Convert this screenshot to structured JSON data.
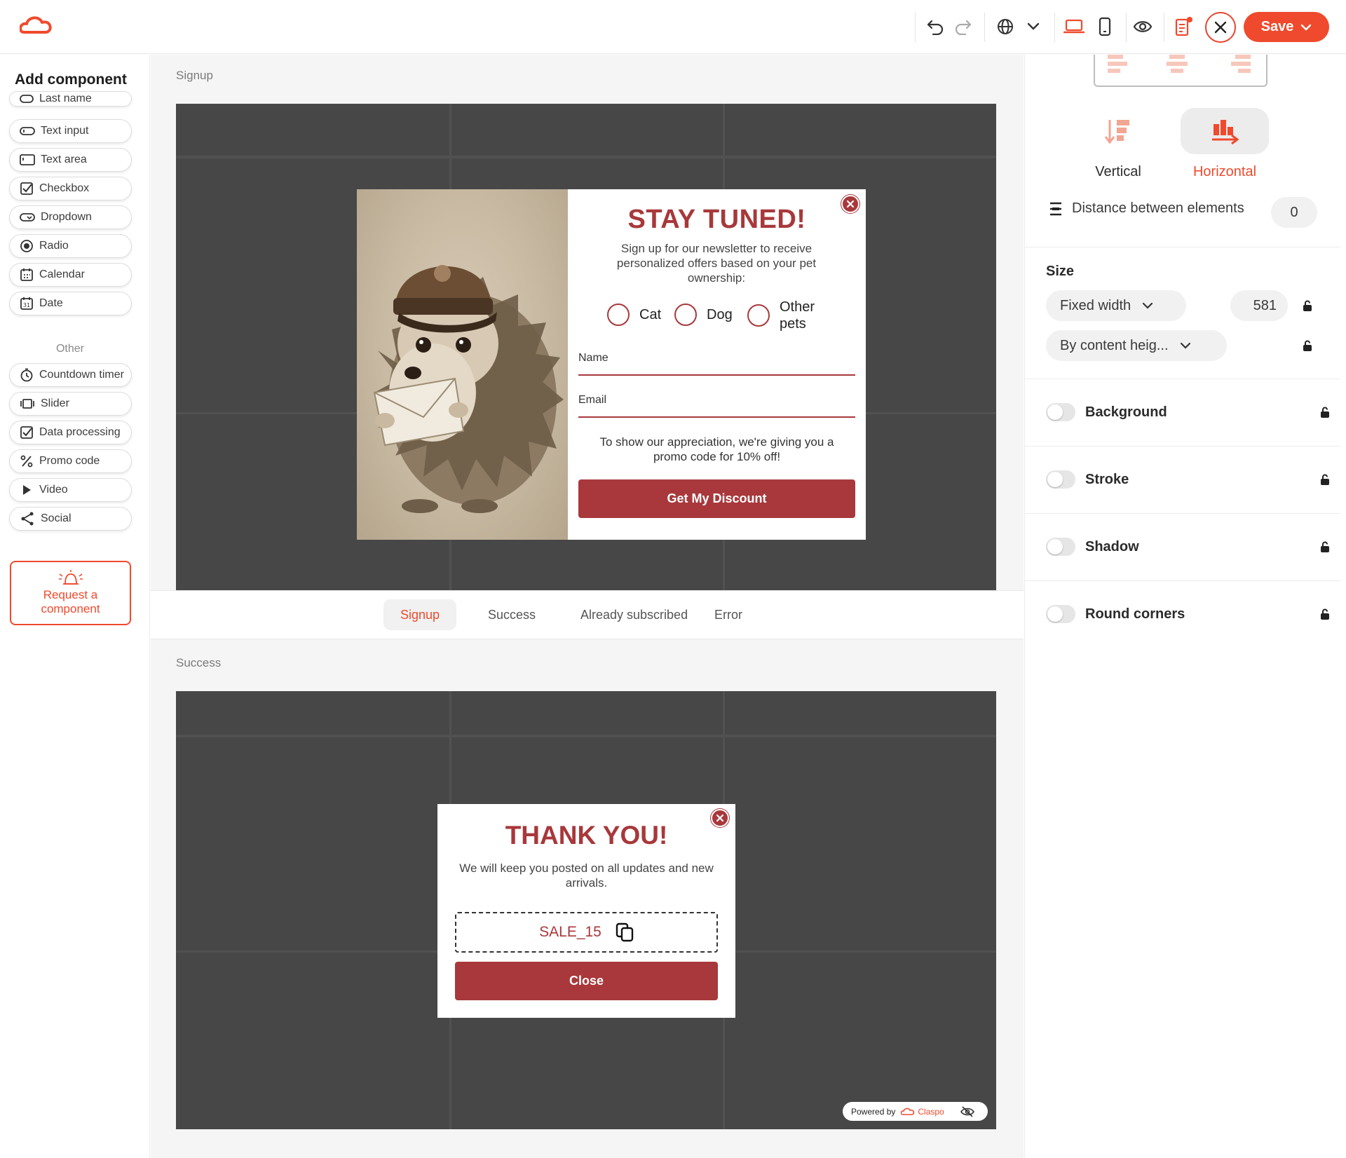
{
  "toolbar": {
    "save_label": "Save",
    "accent": "#ef4a2d"
  },
  "sidebar": {
    "title": "Add component",
    "items_top": [
      {
        "label": "Last name",
        "icon": "text-input-icon"
      },
      {
        "label": "Text input",
        "icon": "text-input-icon"
      },
      {
        "label": "Text area",
        "icon": "text-area-icon"
      },
      {
        "label": "Checkbox",
        "icon": "checkbox-icon"
      },
      {
        "label": "Dropdown",
        "icon": "dropdown-icon"
      },
      {
        "label": "Radio",
        "icon": "radio-icon"
      },
      {
        "label": "Calendar",
        "icon": "calendar-icon"
      },
      {
        "label": "Date",
        "icon": "date-icon"
      }
    ],
    "section_other": "Other",
    "items_other": [
      {
        "label": "Countdown timer",
        "icon": "timer-icon"
      },
      {
        "label": "Slider",
        "icon": "slider-icon"
      },
      {
        "label": "Data processing",
        "icon": "checkbox-icon"
      },
      {
        "label": "Promo code",
        "icon": "percent-icon"
      },
      {
        "label": "Video",
        "icon": "play-icon"
      },
      {
        "label": "Social",
        "icon": "share-icon"
      }
    ],
    "request_line1": "Request a",
    "request_line2": "component"
  },
  "canvas": {
    "signup_label": "Signup",
    "success_label": "Success",
    "tabs": [
      "Signup",
      "Success",
      "Already subscribed",
      "Error"
    ],
    "active_tab": "Signup",
    "popup_signup": {
      "title": "STAY TUNED!",
      "subtitle": "Sign up for our newsletter to receive personalized offers based on your pet ownership:",
      "options": [
        "Cat",
        "Dog",
        "Other pets"
      ],
      "name_label": "Name",
      "email_label": "Email",
      "note": "To show our appreciation, we're giving you a promo code for 10% off!",
      "button": "Get My Discount"
    },
    "popup_success": {
      "title": "THANK YOU!",
      "subtitle": "We will keep you posted on all updates and new arrivals.",
      "promo_code": "SALE_15",
      "button": "Close"
    },
    "powered_by": "Powered by",
    "brand": "Claspo",
    "popup_accent": "#a8383b"
  },
  "panel": {
    "direction_vertical": "Vertical",
    "direction_horizontal": "Horizontal",
    "direction_selected": "Horizontal",
    "distance_label": "Distance between elements",
    "distance_value": "0",
    "size_title": "Size",
    "width_mode": "Fixed width",
    "width_value": "581",
    "height_mode": "By content heig...",
    "toggles": [
      {
        "label": "Background",
        "on": false
      },
      {
        "label": "Stroke",
        "on": false
      },
      {
        "label": "Shadow",
        "on": false
      },
      {
        "label": "Round corners",
        "on": false
      }
    ]
  }
}
